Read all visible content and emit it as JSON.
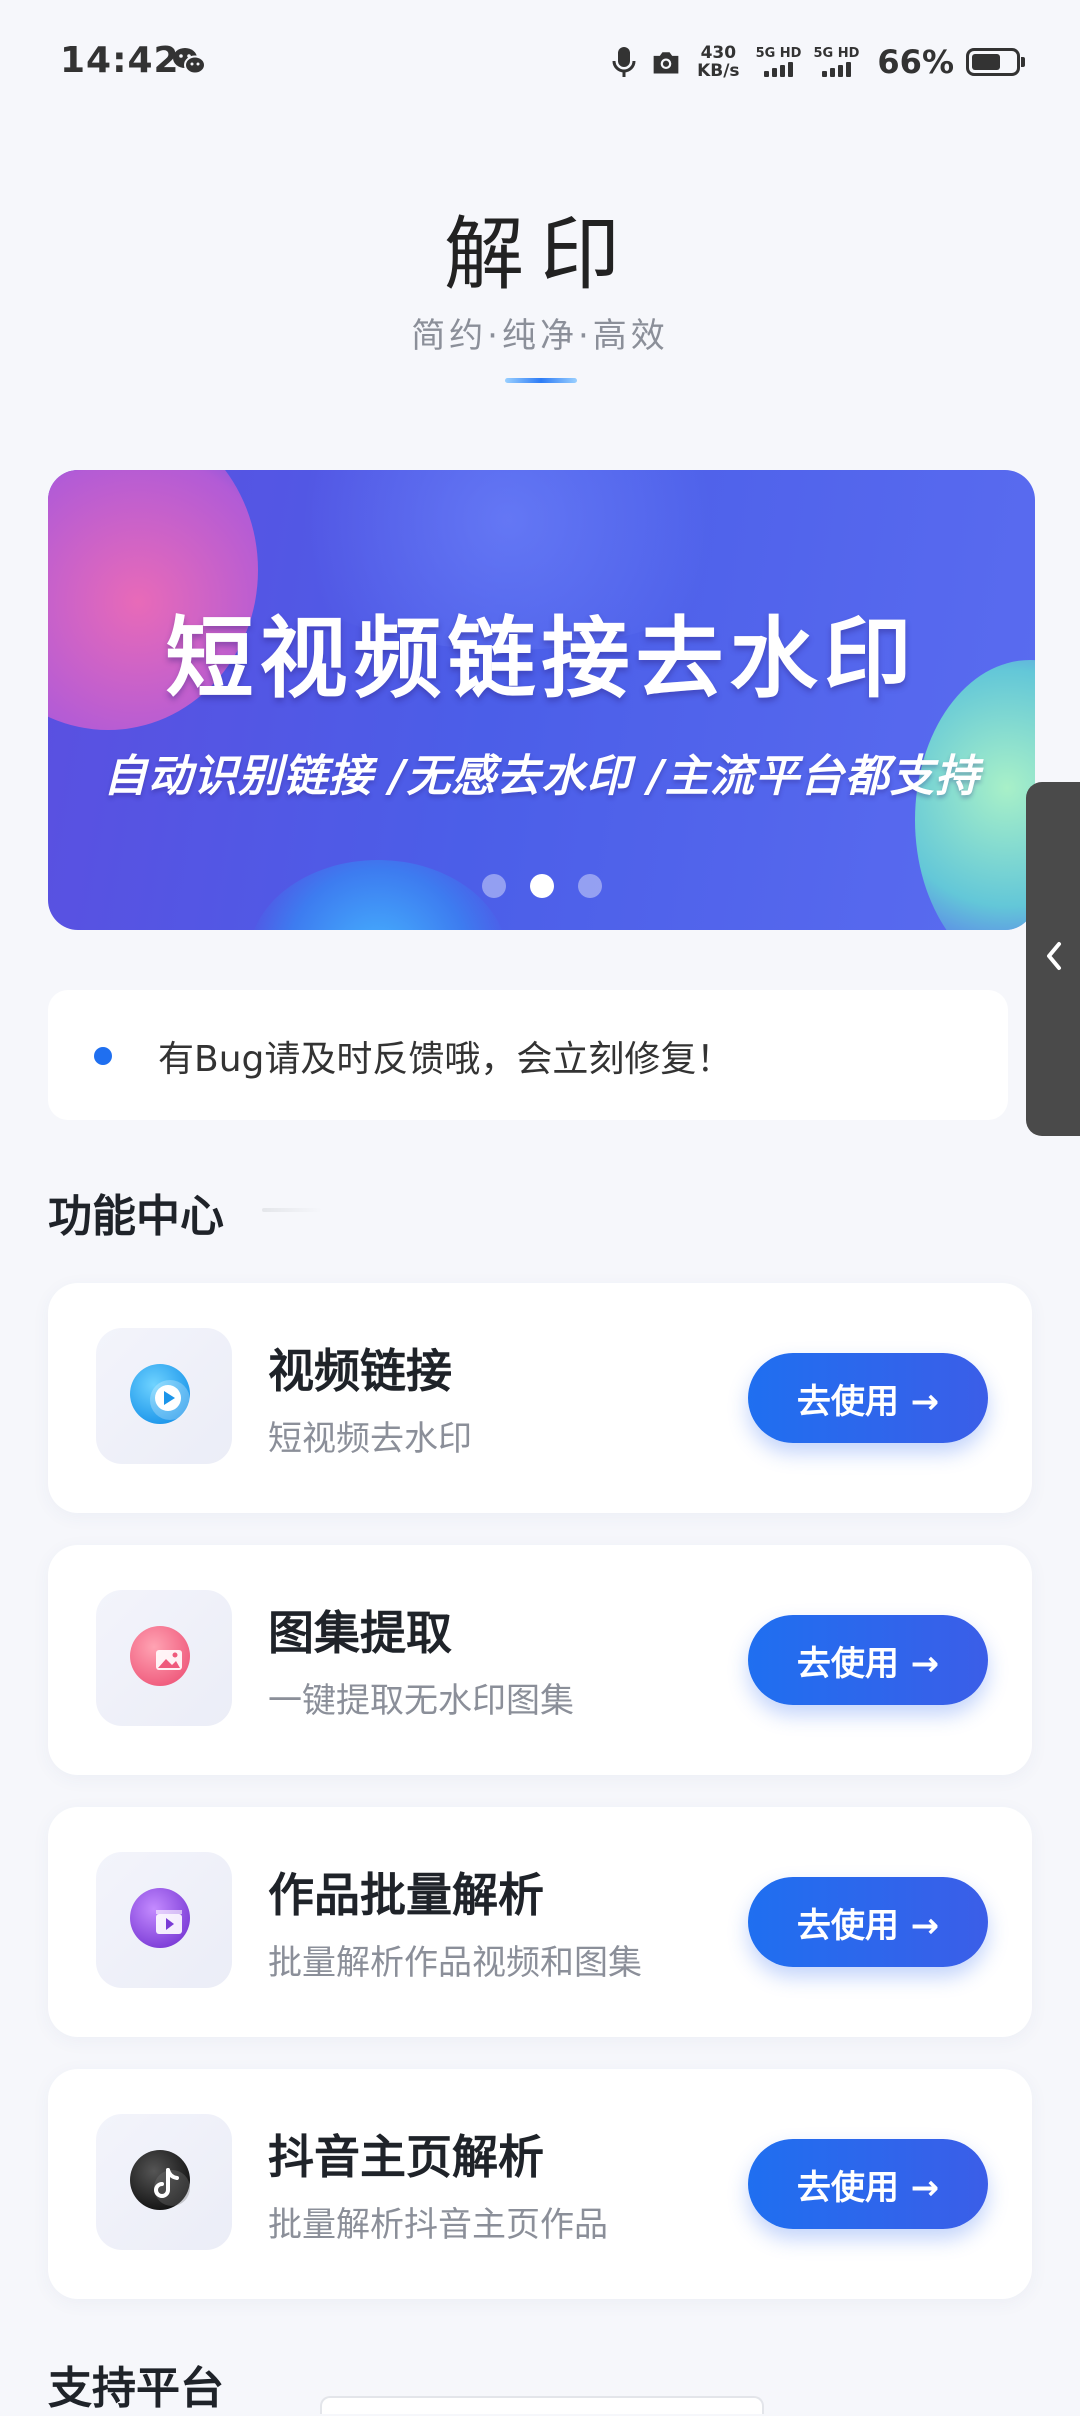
{
  "status_bar": {
    "time": "14:42",
    "net_speed_value": "430",
    "net_speed_unit": "KB/s",
    "sim1_label": "5G HD",
    "sim2_label": "5G HD",
    "battery": "66%",
    "battery_level": 0.66
  },
  "header": {
    "title": "解印",
    "subtitle": "简约·纯净·高效"
  },
  "banner": {
    "title": "短视频链接去水印",
    "subtitle": "自动识别链接 /无感去水印 /主流平台都支持",
    "active_slide": 2,
    "slide_count": 3
  },
  "notice": {
    "text": "有Bug请及时反馈哦，会立刻修复！"
  },
  "features_section": {
    "title": "功能中心",
    "items": [
      {
        "title": "视频链接",
        "desc": "短视频去水印",
        "button": "去使用 →",
        "icon": "video-play-icon",
        "color": "#29a6f2"
      },
      {
        "title": "图集提取",
        "desc": "一键提取无水印图集",
        "button": "去使用 →",
        "icon": "image-gallery-icon",
        "color": "#f36d8a"
      },
      {
        "title": "作品批量解析",
        "desc": "批量解析作品视频和图集",
        "button": "去使用 →",
        "icon": "batch-video-icon",
        "color": "#8e4fe0"
      },
      {
        "title": "抖音主页解析",
        "desc": "批量解析抖音主页作品",
        "button": "去使用 →",
        "icon": "tiktok-icon",
        "color": "#222222"
      }
    ]
  },
  "platforms_section": {
    "title": "支持平台"
  }
}
